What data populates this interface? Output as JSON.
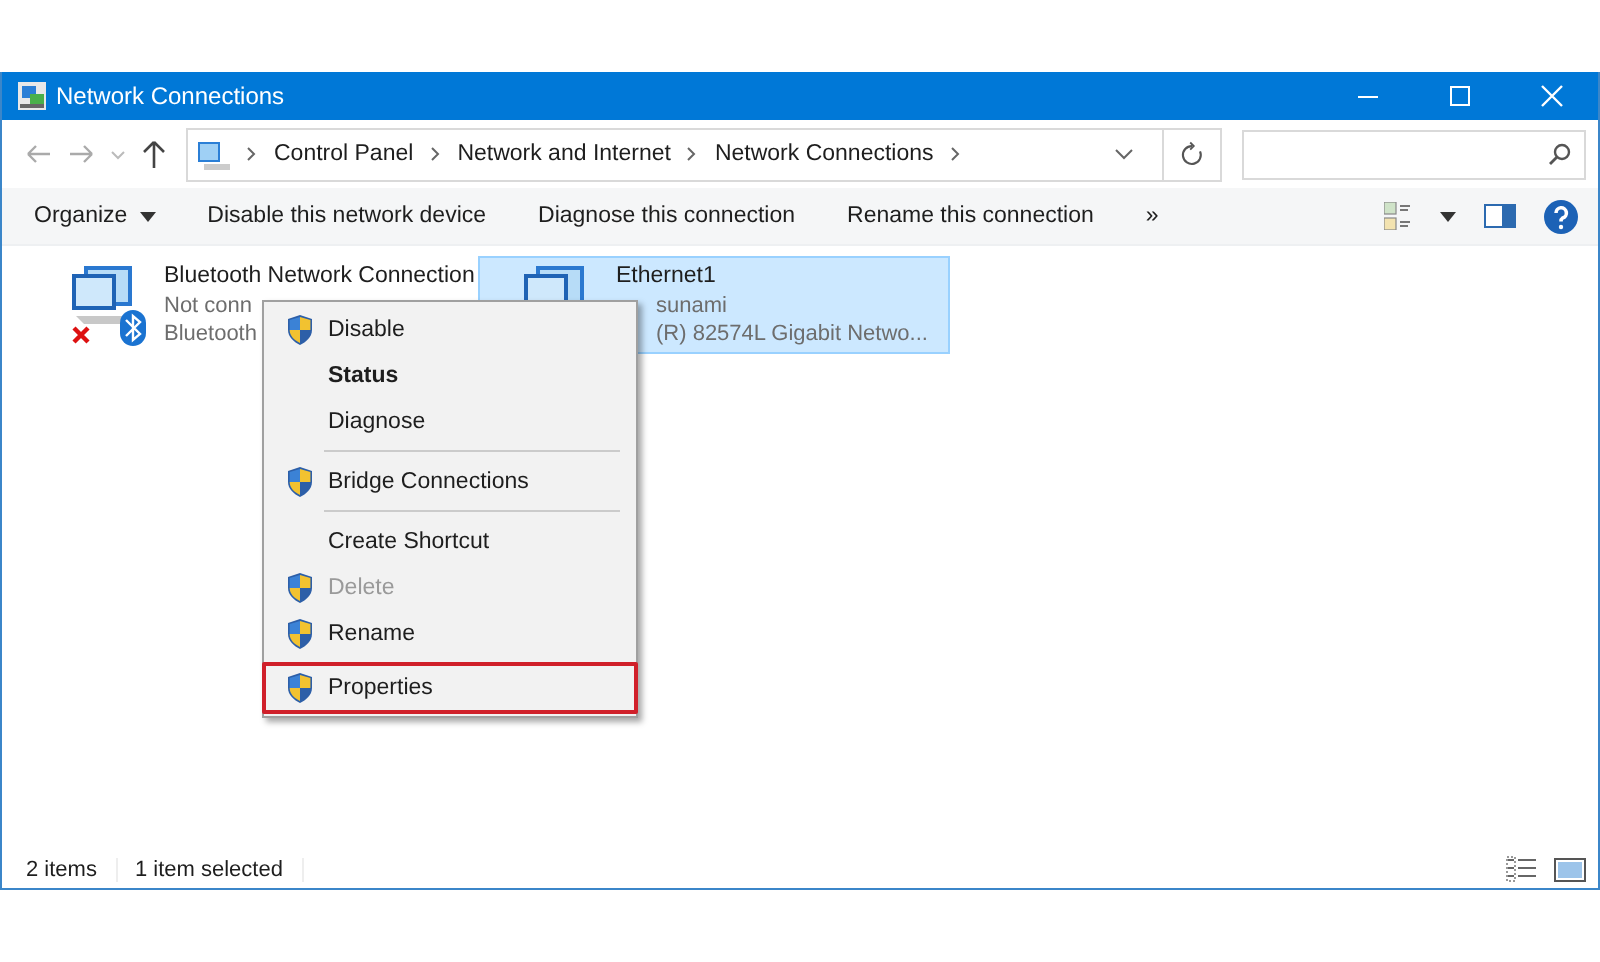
{
  "window": {
    "title": "Network Connections"
  },
  "address": {
    "breadcrumbs": [
      "Control Panel",
      "Network and Internet",
      "Network Connections"
    ]
  },
  "toolbar": {
    "items": [
      {
        "label": "Organize",
        "dropdown": true
      },
      {
        "label": "Disable this network device",
        "dropdown": false
      },
      {
        "label": "Diagnose this connection",
        "dropdown": false
      },
      {
        "label": "Rename this connection",
        "dropdown": false
      },
      {
        "label": "»",
        "dropdown": false
      }
    ]
  },
  "connections": [
    {
      "name": "Bluetooth Network Connection",
      "lines": [
        "Not conn",
        "Bluetooth"
      ],
      "selected": false,
      "disconnected": true,
      "bluetooth": true
    },
    {
      "name": "Ethernet1",
      "lines": [
        "sunami",
        "(R) 82574L Gigabit Netwo..."
      ],
      "selected": true,
      "disconnected": false,
      "bluetooth": false
    }
  ],
  "context_menu": [
    {
      "kind": "item",
      "label": "Disable",
      "shield": true,
      "bold": false,
      "disabled": false,
      "highlighted": false
    },
    {
      "kind": "item",
      "label": "Status",
      "shield": false,
      "bold": true,
      "disabled": false,
      "highlighted": false
    },
    {
      "kind": "item",
      "label": "Diagnose",
      "shield": false,
      "bold": false,
      "disabled": false,
      "highlighted": false
    },
    {
      "kind": "separator"
    },
    {
      "kind": "item",
      "label": "Bridge Connections",
      "shield": true,
      "bold": false,
      "disabled": false,
      "highlighted": false
    },
    {
      "kind": "separator"
    },
    {
      "kind": "item",
      "label": "Create Shortcut",
      "shield": false,
      "bold": false,
      "disabled": false,
      "highlighted": false
    },
    {
      "kind": "item",
      "label": "Delete",
      "shield": true,
      "bold": false,
      "disabled": true,
      "highlighted": false
    },
    {
      "kind": "item",
      "label": "Rename",
      "shield": true,
      "bold": false,
      "disabled": false,
      "highlighted": false
    },
    {
      "kind": "item",
      "label": "Properties",
      "shield": true,
      "bold": false,
      "disabled": false,
      "highlighted": true
    }
  ],
  "status_bar": [
    "2 items",
    "1 item selected"
  ]
}
